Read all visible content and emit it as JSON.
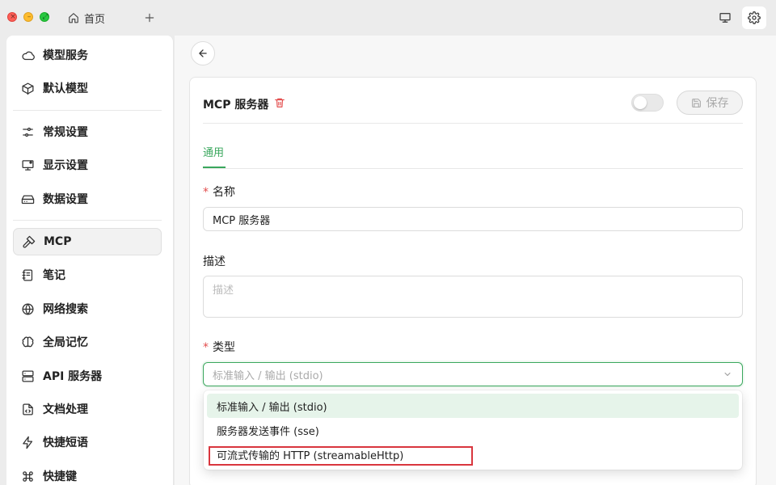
{
  "titlebar": {
    "home_tab_label": "首页",
    "add_tab_symbol": "+"
  },
  "sidebar": {
    "items": [
      {
        "label": "模型服务",
        "icon": "cloud-icon"
      },
      {
        "label": "默认模型",
        "icon": "cube-icon"
      },
      {
        "label": "常规设置",
        "icon": "sliders-icon"
      },
      {
        "label": "显示设置",
        "icon": "monitor-icon"
      },
      {
        "label": "数据设置",
        "icon": "drive-icon"
      },
      {
        "label": "MCP",
        "icon": "hammer-icon",
        "active": true
      },
      {
        "label": "笔记",
        "icon": "notebook-icon"
      },
      {
        "label": "网络搜索",
        "icon": "globe-icon"
      },
      {
        "label": "全局记忆",
        "icon": "brain-icon"
      },
      {
        "label": "API 服务器",
        "icon": "server-icon"
      },
      {
        "label": "文档处理",
        "icon": "file-code-icon"
      },
      {
        "label": "快捷短语",
        "icon": "zap-icon"
      },
      {
        "label": "快捷键",
        "icon": "command-icon"
      }
    ]
  },
  "card": {
    "title": "MCP 服务器",
    "enabled": false,
    "save_label": "保存",
    "tabs": [
      {
        "label": "通用",
        "active": true
      }
    ],
    "fields": {
      "name": {
        "label": "名称",
        "required": true,
        "value": "MCP 服务器"
      },
      "description": {
        "label": "描述",
        "required": false,
        "placeholder": "描述",
        "value": ""
      },
      "type": {
        "label": "类型",
        "required": true,
        "value": "标准输入 / 输出 (stdio)"
      }
    }
  },
  "dropdown": {
    "options": [
      {
        "label": "标准输入 / 输出 (stdio)",
        "selected": true
      },
      {
        "label": "服务器发送事件 (sse)",
        "selected": false
      },
      {
        "label": "可流式传输的 HTTP (streamableHttp)",
        "selected": false,
        "highlighted": true
      }
    ]
  },
  "colors": {
    "accent": "#3aa75d",
    "required": "#e34d4d",
    "highlight_box": "#d9363e"
  }
}
